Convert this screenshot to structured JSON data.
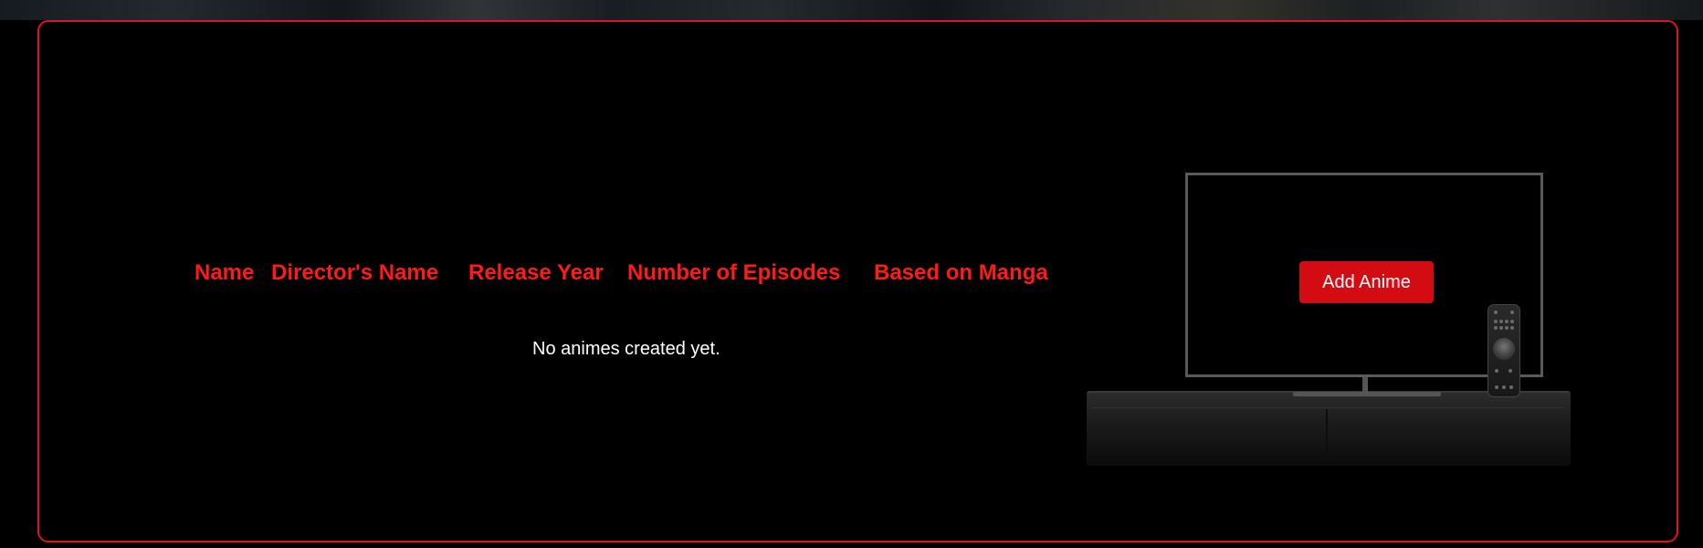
{
  "table": {
    "headers": [
      "Name",
      "Director's Name",
      "Release Year",
      "Number of Episodes",
      "Based on Manga"
    ],
    "empty_message": "No animes created yet."
  },
  "actions": {
    "add_label": "Add Anime"
  },
  "icons": {
    "tv": "tv-icon",
    "remote": "remote-control-icon"
  },
  "colors": {
    "accent": "#e0141c",
    "button": "#d30b12",
    "background": "#000000",
    "text": "#ffffff"
  }
}
